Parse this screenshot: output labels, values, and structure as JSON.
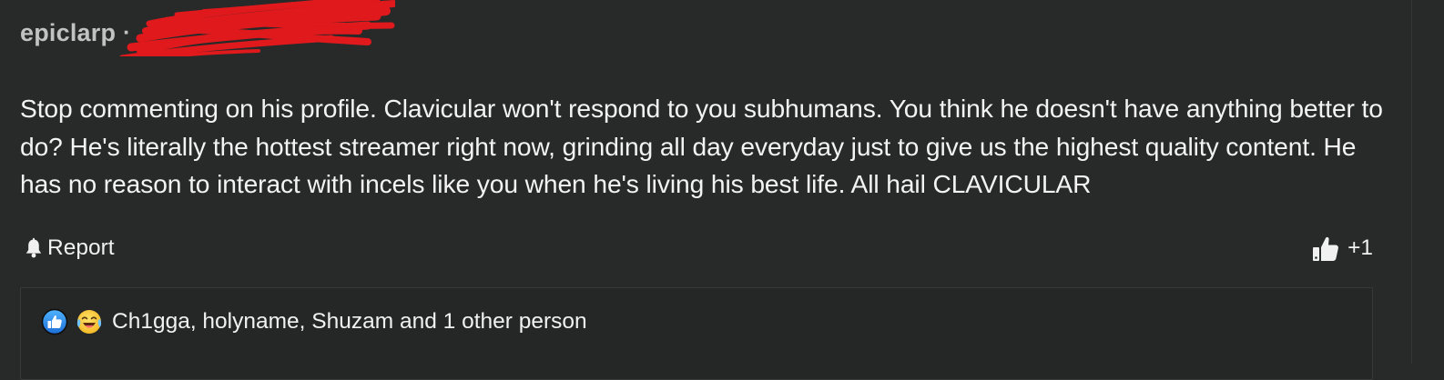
{
  "comment": {
    "username": "epiclarp",
    "separator": "·",
    "body": "Stop commenting on his profile. Clavicular won't respond to you subhumans. You think he doesn't have anything better to do? He's literally the hottest streamer right now, grinding all day everyday just to give us the highest quality content. He has no reason to interact with incels like you when he's living his best life. All hail CLAVICULAR"
  },
  "actions": {
    "report_label": "Report",
    "report_icon": "bell-icon",
    "like_icon": "thumbs-up-icon",
    "like_count": "+1"
  },
  "reactions": {
    "icons": [
      "thumbs-up-reaction-icon",
      "laughing-crying-emoji-icon"
    ],
    "reactors_text": "Ch1gga, holyname, Shuzam and 1 other person"
  },
  "colors": {
    "background": "#282929",
    "username": "#c2c2c2",
    "text": "#f3f3f3",
    "redaction": "#e0191d",
    "like_reaction_blue": "#2f8ee8"
  }
}
